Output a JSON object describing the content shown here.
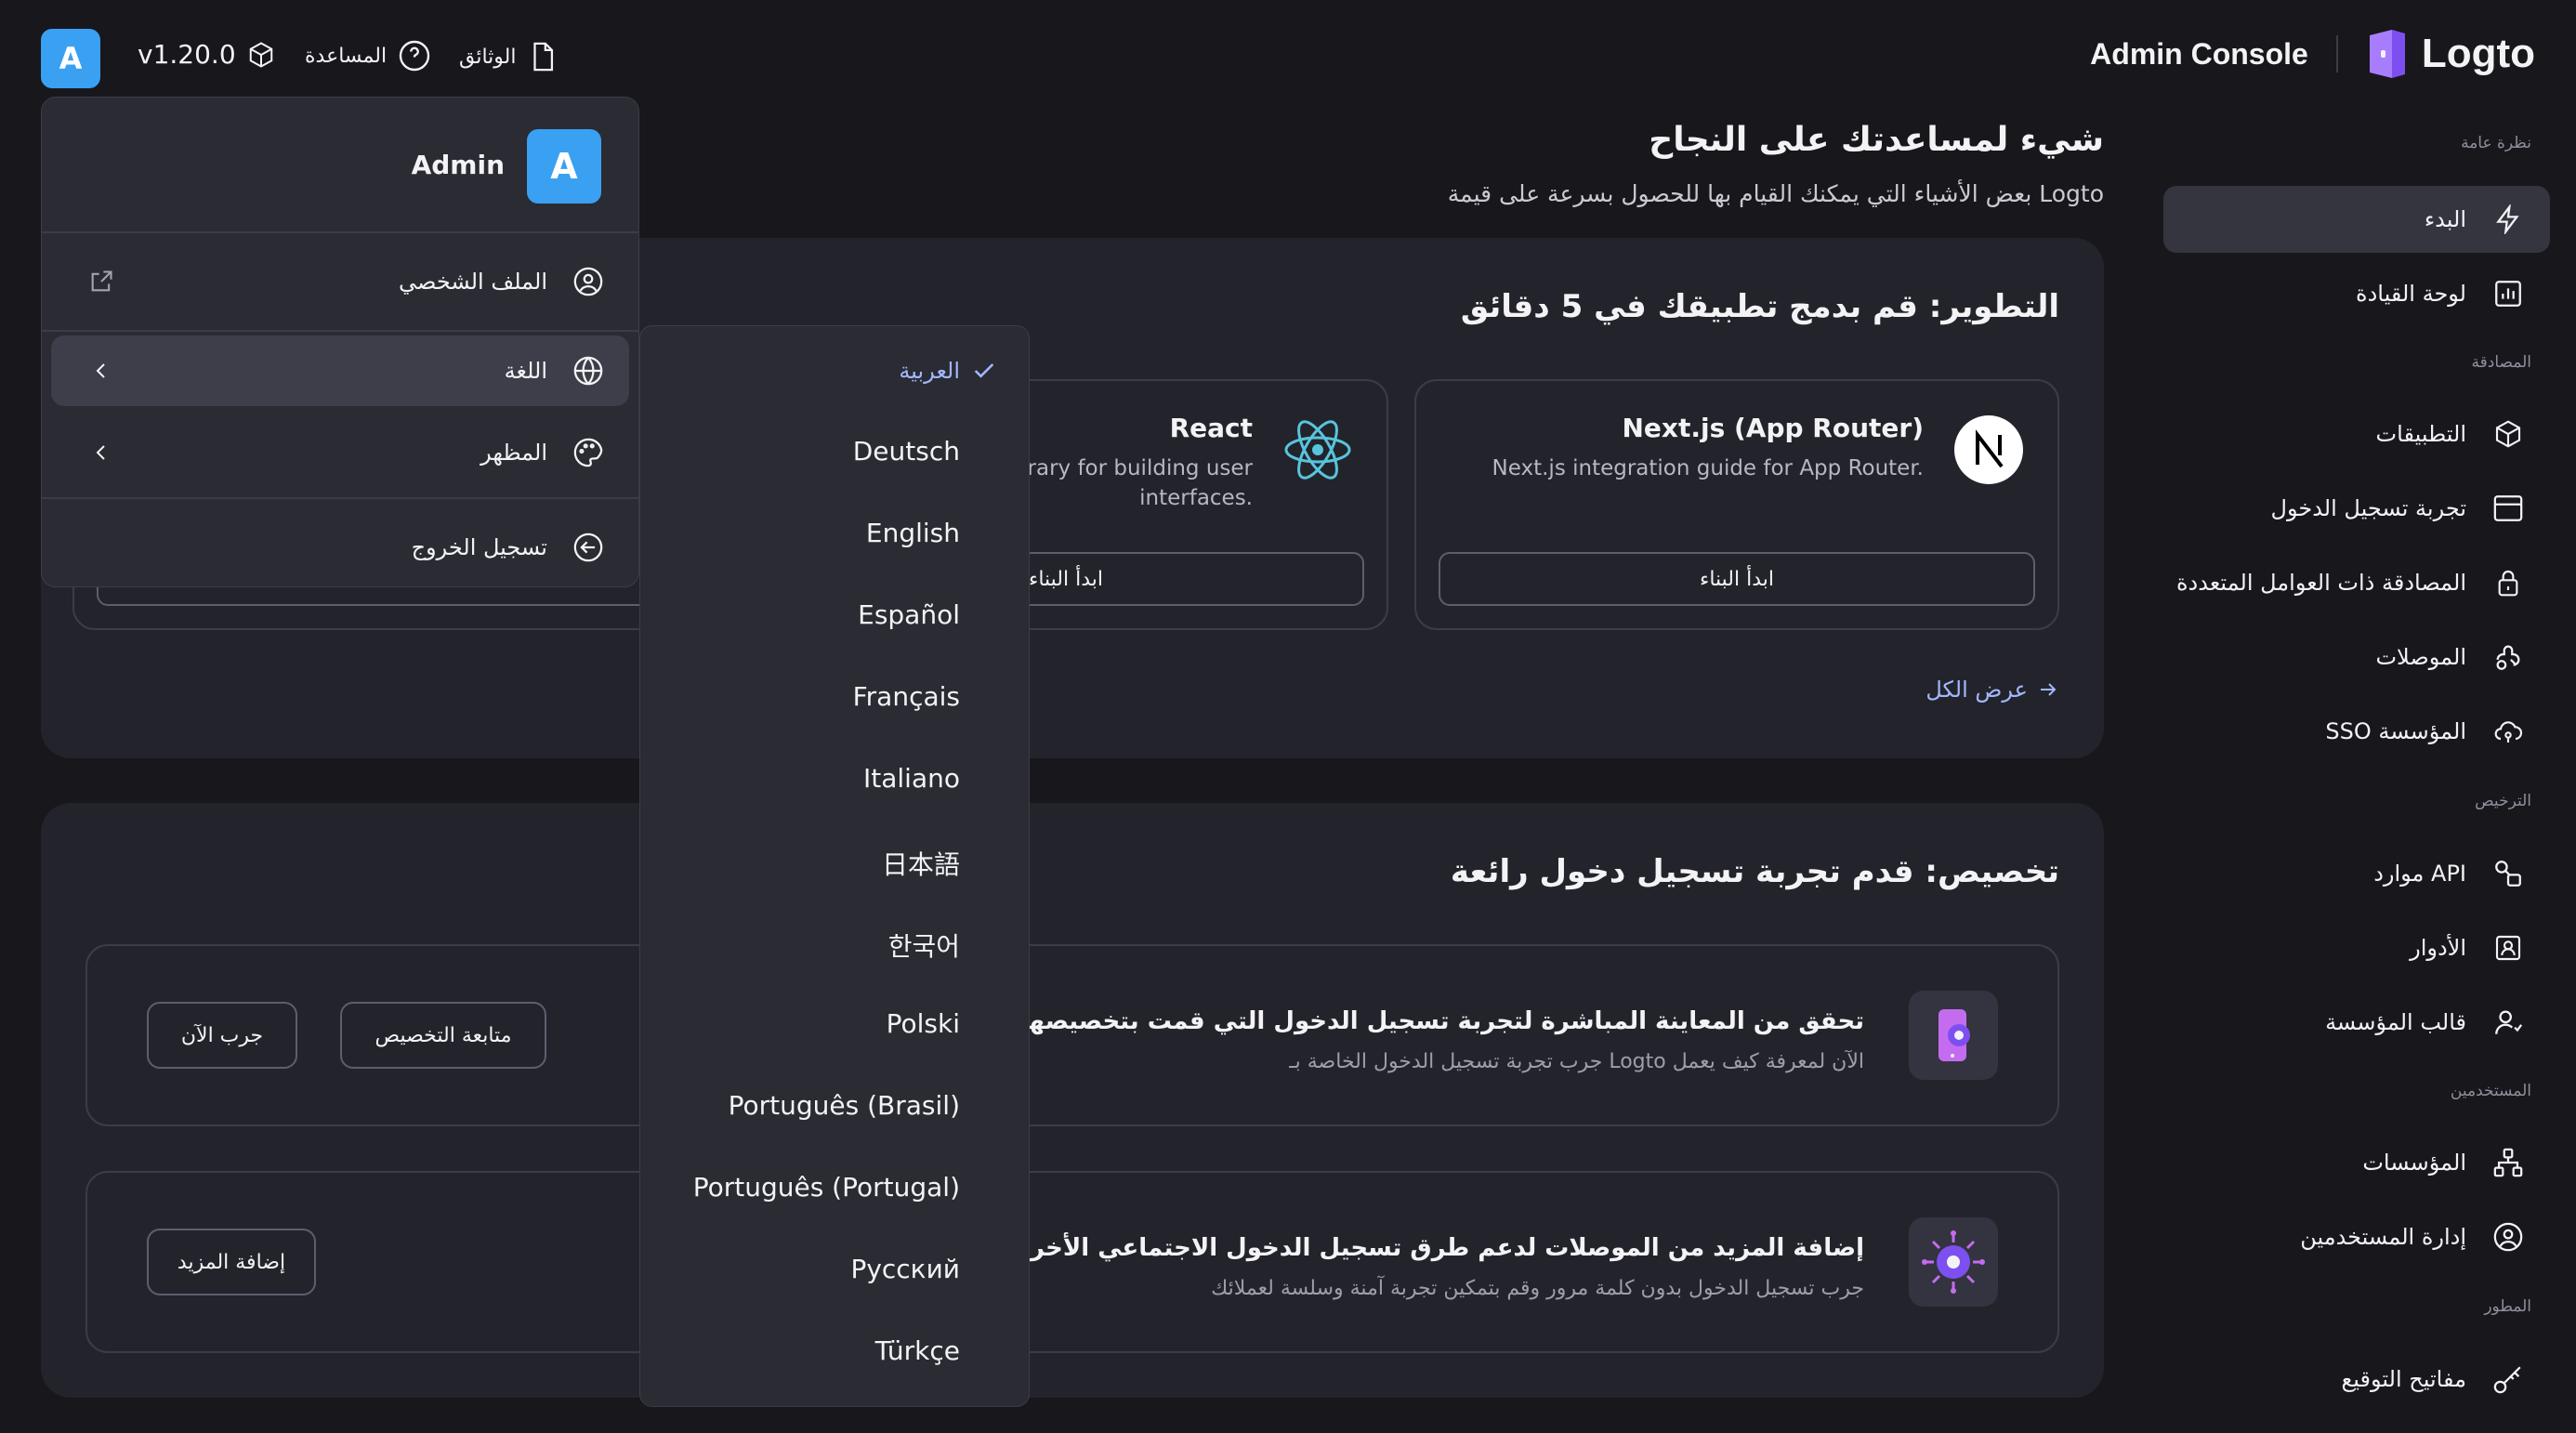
{
  "topbar": {
    "avatar_letter": "A",
    "version": "v1.20.0",
    "help": "المساعدة",
    "docs": "الوثائق",
    "console": "Admin Console",
    "brand": "Logto"
  },
  "sidebar": {
    "sections": [
      {
        "title": "نظرة عامة"
      },
      {
        "title": "المصادقة"
      },
      {
        "title": "الترخيص"
      },
      {
        "title": "المستخدمين"
      },
      {
        "title": "المطور"
      }
    ],
    "items": [
      {
        "label": "البدء",
        "icon": "lightning-icon",
        "active": true
      },
      {
        "label": "لوحة القيادة",
        "icon": "bar-chart-icon"
      },
      {
        "label": "التطبيقات",
        "icon": "cube-icon"
      },
      {
        "label": "تجربة تسجيل الدخول",
        "icon": "browser-window-icon"
      },
      {
        "label": "المصادقة ذات العوامل المتعددة",
        "icon": "lock-icon"
      },
      {
        "label": "الموصلات",
        "icon": "connectors-icon"
      },
      {
        "label": "SSO المؤسسة",
        "icon": "cloud-key-icon"
      },
      {
        "label": "موارد API",
        "icon": "api-resource-icon"
      },
      {
        "label": "الأدوار",
        "icon": "role-badge-icon"
      },
      {
        "label": "قالب المؤسسة",
        "icon": "user-template-icon"
      },
      {
        "label": "المؤسسات",
        "icon": "org-tree-icon"
      },
      {
        "label": "إدارة المستخدمين",
        "icon": "user-circle-icon"
      },
      {
        "label": "مفاتيح التوقيع",
        "icon": "key-icon"
      }
    ]
  },
  "main": {
    "title": "شيء لمساعدتك على النجاح",
    "subtitle": "بعض الأشياء التي يمكنك القيام بها للحصول بسرعة على قيمة Logto",
    "develop": {
      "title": "التطوير: قم بدمج تطبيقك في 5 دقائق",
      "frameworks": [
        {
          "name": "Next.js (App Router)",
          "desc": "Next.js integration guide for App Router.",
          "button": "ابدأ البناء"
        },
        {
          "name": "React",
          "desc_line1": "library for building user",
          "desc_line2": "interfaces.",
          "button": "ابدأ البناء"
        }
      ],
      "view_all": "عرض الكل"
    },
    "customize": {
      "title": "تخصيص: قدم تجربة تسجيل دخول رائعة",
      "rows": [
        {
          "title": "تحقق من المعاينة المباشرة لتجربة تسجيل الدخول التي قمت بتخصيصها للتو",
          "subtitle": "جرب تجربة تسجيل الدخول الخاصة بـ Logto الآن لمعرفة كيف يعمل",
          "buttons": [
            "متابعة التخصيص",
            "جرب الآن"
          ]
        },
        {
          "title": "إضافة المزيد من الموصلات لدعم طرق تسجيل الدخول الاجتماعي الأخرى",
          "subtitle": "جرب تسجيل الدخول بدون كلمة مرور وقم بتمكين تجربة آمنة وسلسة لعملائك",
          "buttons": [
            "إضافة المزيد"
          ]
        }
      ]
    }
  },
  "user_menu": {
    "name": "Admin",
    "avatar_letter": "A",
    "items": [
      {
        "label": "الملف الشخصي",
        "icon": "user-circle-icon"
      },
      {
        "label": "اللغة",
        "icon": "globe-icon"
      },
      {
        "label": "المظهر",
        "icon": "palette-icon"
      },
      {
        "label": "تسجيل الخروج",
        "icon": "sign-out-icon"
      }
    ]
  },
  "language_menu": {
    "selected": "العربية",
    "options": [
      "Deutsch",
      "English",
      "Español",
      "Français",
      "Italiano",
      "日本語",
      "한국어",
      "Polski",
      "Português (Brasil)",
      "Português (Portugal)",
      "Русский",
      "Türkçe"
    ]
  },
  "colors": {
    "background": "#17171c",
    "card": "#23242b",
    "menu": "#2a2b33",
    "accent": "#3aa0f2",
    "link": "#a3b7ff",
    "brand": "#a87dfd"
  }
}
